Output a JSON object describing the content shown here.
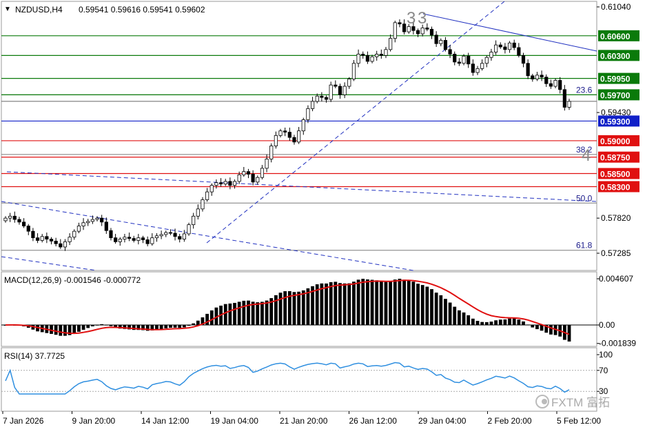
{
  "header": {
    "symbol_tf": "NZDUSD,H4",
    "ohlc": "0.59541 0.59616 0.59541 0.59602"
  },
  "price_axis": {
    "ticks": [
      "0.61040",
      "0.59430",
      "0.57820",
      "0.57285"
    ],
    "ylim": [
      0.5708,
      0.6114
    ]
  },
  "levels": [
    {
      "price": 0.606,
      "label": "0.60600",
      "kind": "resistance"
    },
    {
      "price": 0.603,
      "label": "0.60300",
      "kind": "resistance"
    },
    {
      "price": 0.5995,
      "label": "0.59950",
      "kind": "resistance"
    },
    {
      "price": 0.597,
      "label": "0.59700",
      "kind": "resistance"
    },
    {
      "price": 0.593,
      "label": "0.59300",
      "kind": "current"
    },
    {
      "price": 0.59,
      "label": "0.59000",
      "kind": "support"
    },
    {
      "price": 0.5875,
      "label": "0.58750",
      "kind": "support"
    },
    {
      "price": 0.585,
      "label": "0.58500",
      "kind": "support"
    },
    {
      "price": 0.583,
      "label": "0.58300",
      "kind": "support"
    }
  ],
  "fib_levels": [
    {
      "label": "23.6",
      "price": 0.597
    },
    {
      "label": "38.2",
      "price": 0.5879
    },
    {
      "label": "50.0",
      "price": 0.5805
    },
    {
      "label": "61.8",
      "price": 0.5733
    }
  ],
  "wave_labels": {
    "top": "3",
    "bottom": "4"
  },
  "macd": {
    "title": "MACD(12,26,9) -0.001546 -0.000772",
    "ticks": [
      "0.004607",
      "0.00",
      "-0.001839"
    ],
    "ylim": [
      -0.003,
      0.005
    ]
  },
  "rsi": {
    "title": "RSI(14) 37.7725",
    "ticks": [
      "100",
      "70",
      "30"
    ],
    "ylim": [
      0,
      100
    ]
  },
  "time_axis": {
    "labels": [
      "7 Jan 2026",
      "9 Jan 20:00",
      "14 Jan 12:00",
      "19 Jan 04:00",
      "21 Jan 20:00",
      "26 Jan 12:00",
      "29 Jan 04:00",
      "2 Feb 20:00",
      "5 Feb 12:00"
    ]
  },
  "watermark": "FXTM 富拓",
  "colors": {
    "resistance": "#0a7a0a",
    "support": "#e01010",
    "current": "#1020c8",
    "trend": "#2030c0",
    "macd_signal": "#e01010",
    "rsi_line": "#2f8fe0"
  },
  "chart_data": {
    "type": "candlestick",
    "series_note": "NZDUSD H4 closes",
    "close": [
      0.5782,
      0.5785,
      0.578,
      0.5776,
      0.577,
      0.5762,
      0.5752,
      0.5748,
      0.5754,
      0.575,
      0.5747,
      0.5743,
      0.5738,
      0.5746,
      0.5753,
      0.5762,
      0.577,
      0.5775,
      0.5777,
      0.578,
      0.5782,
      0.5776,
      0.5763,
      0.5752,
      0.5746,
      0.575,
      0.5753,
      0.5751,
      0.5748,
      0.5752,
      0.5749,
      0.5743,
      0.5752,
      0.5755,
      0.5757,
      0.576,
      0.5759,
      0.5754,
      0.575,
      0.5758,
      0.5772,
      0.5785,
      0.5796,
      0.581,
      0.5822,
      0.5832,
      0.5836,
      0.5834,
      0.5838,
      0.5832,
      0.5838,
      0.5848,
      0.5853,
      0.5849,
      0.5837,
      0.5844,
      0.5858,
      0.5872,
      0.5892,
      0.5908,
      0.5915,
      0.5913,
      0.5905,
      0.5898,
      0.5915,
      0.5932,
      0.5949,
      0.596,
      0.5968,
      0.5966,
      0.5963,
      0.5985,
      0.5983,
      0.597,
      0.5983,
      0.5994,
      0.6018,
      0.6032,
      0.603,
      0.6021,
      0.6028,
      0.6032,
      0.603,
      0.6039,
      0.6056,
      0.608,
      0.6078,
      0.6066,
      0.6074,
      0.6068,
      0.6063,
      0.6072,
      0.607,
      0.6061,
      0.6048,
      0.6053,
      0.6039,
      0.6032,
      0.602,
      0.6018,
      0.6029,
      0.6017,
      0.6004,
      0.601,
      0.6018,
      0.6027,
      0.6035,
      0.6046,
      0.6043,
      0.6039,
      0.6049,
      0.6042,
      0.603,
      0.6018,
      0.5999,
      0.5994,
      0.6,
      0.5997,
      0.5987,
      0.5983,
      0.5992,
      0.5978,
      0.5951,
      0.596
    ]
  }
}
